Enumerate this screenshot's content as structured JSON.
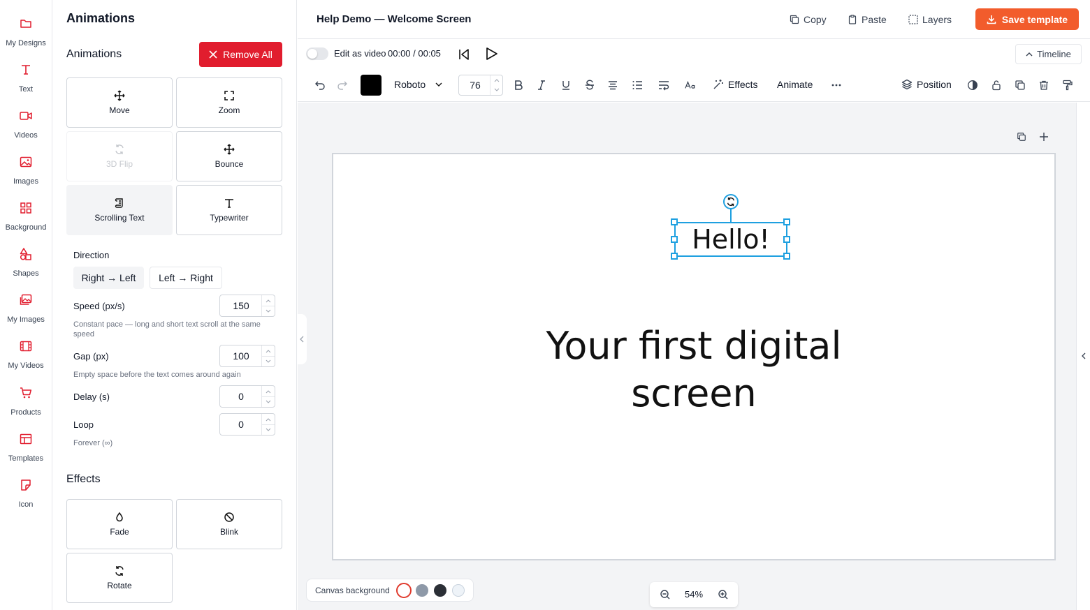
{
  "rail": {
    "items": [
      {
        "label": "My Designs",
        "icon": "folder-icon"
      },
      {
        "label": "Text",
        "icon": "text-icon"
      },
      {
        "label": "Videos",
        "icon": "video-icon"
      },
      {
        "label": "Images",
        "icon": "image-icon"
      },
      {
        "label": "Background",
        "icon": "grid-icon"
      },
      {
        "label": "Shapes",
        "icon": "shapes-icon"
      },
      {
        "label": "My Images",
        "icon": "my-images-icon"
      },
      {
        "label": "My Videos",
        "icon": "film-icon"
      },
      {
        "label": "Products",
        "icon": "cart-icon"
      },
      {
        "label": "Templates",
        "icon": "template-icon"
      },
      {
        "label": "Icon",
        "icon": "sticker-icon"
      }
    ],
    "accent": "#e11d2e"
  },
  "panel": {
    "title": "Animations",
    "animations_heading": "Animations",
    "remove_all": "Remove All",
    "tiles": {
      "move": "Move",
      "zoom": "Zoom",
      "flip": "3D Flip",
      "bounce": "Bounce",
      "scrolling": "Scrolling Text",
      "typewriter": "Typewriter"
    },
    "direction_label": "Direction",
    "direction_options": {
      "rtl": "Right → Left",
      "ltr": "Left → Right"
    },
    "speed": {
      "label": "Speed (px/s)",
      "value": "150",
      "hint": "Constant pace — long and short text scroll at the same speed"
    },
    "gap": {
      "label": "Gap (px)",
      "value": "100",
      "hint": "Empty space before the text comes around again"
    },
    "delay": {
      "label": "Delay (s)",
      "value": "0"
    },
    "loop": {
      "label": "Loop",
      "value": "0",
      "hint": "Forever (∞)"
    },
    "effects_heading": "Effects",
    "effects": {
      "fade": "Fade",
      "blink": "Blink",
      "rotate": "Rotate"
    }
  },
  "topbar": {
    "title": "Help Demo — Welcome Screen",
    "copy": "Copy",
    "paste": "Paste",
    "layers": "Layers",
    "save": "Save template",
    "save_color": "#f25c2c"
  },
  "playback": {
    "edit_as_video": "Edit as video",
    "time": "00:00 / 00:05",
    "timeline": "Timeline"
  },
  "toolbar": {
    "font": "Roboto",
    "size": "76",
    "effects": "Effects",
    "animate": "Animate",
    "position": "Position",
    "text_color": "#000000"
  },
  "canvas": {
    "selected_text": "Hello!",
    "headline": "Your first digital screen",
    "selection_color": "#1ea0e0"
  },
  "bottom": {
    "canvas_background": "Canvas background",
    "bg_colors": [
      "#ffffff",
      "#8e99a8",
      "#2b2f36",
      "#eef3f8"
    ],
    "zoom": "54%"
  }
}
